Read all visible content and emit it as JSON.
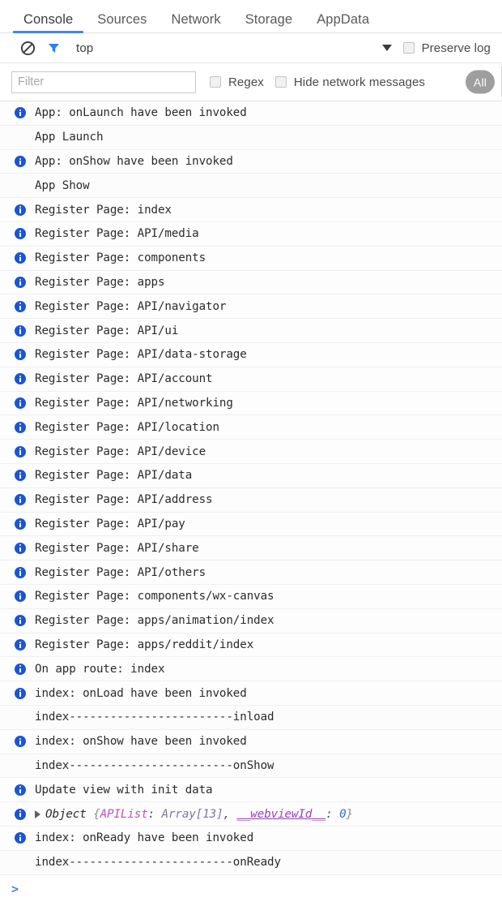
{
  "tabs": [
    {
      "label": "Console",
      "active": true
    },
    {
      "label": "Sources",
      "active": false
    },
    {
      "label": "Network",
      "active": false
    },
    {
      "label": "Storage",
      "active": false
    },
    {
      "label": "AppData",
      "active": false
    }
  ],
  "toolbar": {
    "clear_icon": "clear-console-icon",
    "filter_icon": "filter-funnel-icon",
    "context_label": "top",
    "dropdown_icon": "chevron-down-icon",
    "preserve_log_label": "Preserve log",
    "preserve_log_checked": false
  },
  "filterbar": {
    "filter_placeholder": "Filter",
    "filter_value": "",
    "regex_label": "Regex",
    "regex_checked": false,
    "hide_network_label": "Hide network messages",
    "hide_network_checked": false,
    "level_filter_label": "All"
  },
  "prompt": {
    "caret": ">"
  },
  "colors": {
    "accent": "#4285f4",
    "info_icon": "#1a55d4",
    "pill": "#9e9e9e",
    "object_key": "#c050c0",
    "object_number": "#2f6fd0"
  },
  "log_entries": [
    {
      "icon": "info",
      "text": "App: onLaunch have been invoked"
    },
    {
      "icon": "none",
      "text": "App Launch"
    },
    {
      "icon": "info",
      "text": "App: onShow have been invoked"
    },
    {
      "icon": "none",
      "text": "App Show"
    },
    {
      "icon": "info",
      "text": "Register Page: index"
    },
    {
      "icon": "info",
      "text": "Register Page: API/media"
    },
    {
      "icon": "info",
      "text": "Register Page: components"
    },
    {
      "icon": "info",
      "text": "Register Page: apps"
    },
    {
      "icon": "info",
      "text": "Register Page: API/navigator"
    },
    {
      "icon": "info",
      "text": "Register Page: API/ui"
    },
    {
      "icon": "info",
      "text": "Register Page: API/data-storage"
    },
    {
      "icon": "info",
      "text": "Register Page: API/account"
    },
    {
      "icon": "info",
      "text": "Register Page: API/networking"
    },
    {
      "icon": "info",
      "text": "Register Page: API/location"
    },
    {
      "icon": "info",
      "text": "Register Page: API/device"
    },
    {
      "icon": "info",
      "text": "Register Page: API/data"
    },
    {
      "icon": "info",
      "text": "Register Page: API/address"
    },
    {
      "icon": "info",
      "text": "Register Page: API/pay"
    },
    {
      "icon": "info",
      "text": "Register Page: API/share"
    },
    {
      "icon": "info",
      "text": "Register Page: API/others"
    },
    {
      "icon": "info",
      "text": "Register Page: components/wx-canvas"
    },
    {
      "icon": "info",
      "text": "Register Page: apps/animation/index"
    },
    {
      "icon": "info",
      "text": "Register Page: apps/reddit/index"
    },
    {
      "icon": "info",
      "text": "On app route: index"
    },
    {
      "icon": "info",
      "text": "index: onLoad have been invoked"
    },
    {
      "icon": "none",
      "text": "index------------------------inload"
    },
    {
      "icon": "info",
      "text": "index: onShow have been invoked"
    },
    {
      "icon": "none",
      "text": "index------------------------onShow"
    },
    {
      "icon": "info",
      "text": "Update view with init data"
    }
  ],
  "object_entry": {
    "icon": "info",
    "disclosure": "disclosure-triangle-right",
    "name": "Object",
    "open_brace": "{",
    "key1": "APIList",
    "sep1": ": ",
    "value1": "Array[13]",
    "comma": ", ",
    "key2": "__webviewId__",
    "sep2": ": ",
    "value2": "0",
    "close_brace": "}"
  },
  "log_entries_after": [
    {
      "icon": "info",
      "text": "index: onReady have been invoked"
    },
    {
      "icon": "none",
      "text": "index------------------------onReady"
    }
  ]
}
